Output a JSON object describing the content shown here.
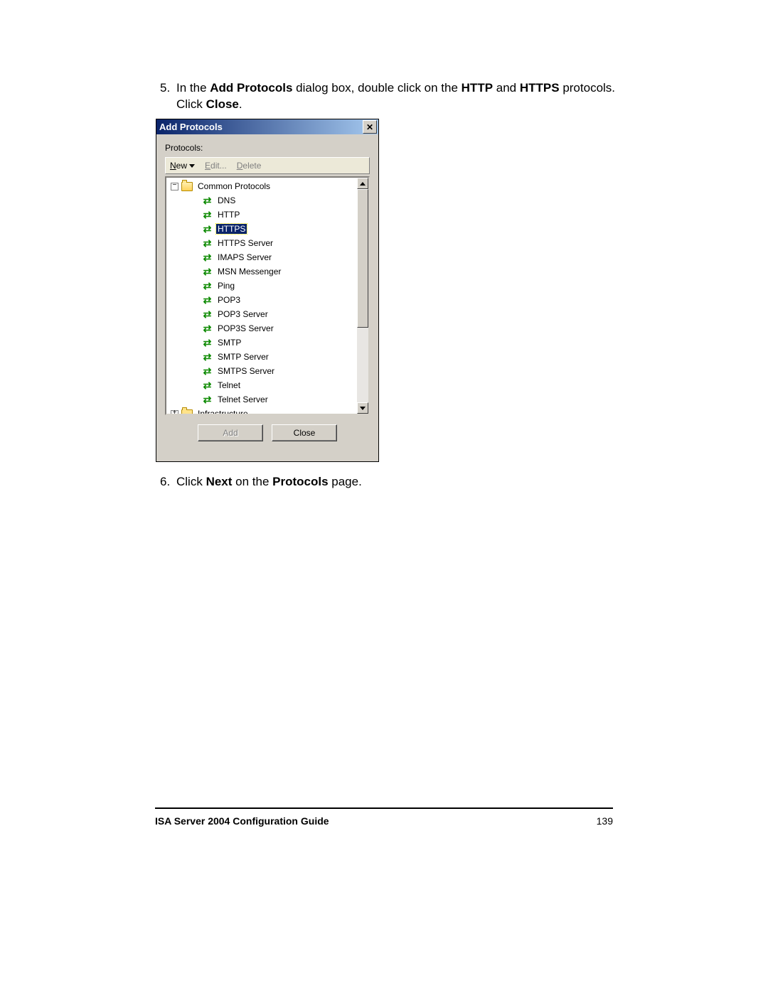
{
  "step5": {
    "num": "5.",
    "pre": "In the ",
    "b1": "Add Protocols",
    "mid1": " dialog box, double click on the ",
    "b2": "HTTP",
    "mid2": " and ",
    "b3": "HTTPS",
    "mid3": " protocols. Click ",
    "b4": "Close",
    "end": "."
  },
  "step6": {
    "num": "6.",
    "pre": "Click ",
    "b1": "Next",
    "mid": " on the ",
    "b2": "Protocols",
    "end": " page."
  },
  "dialog": {
    "title": "Add Protocols",
    "label": "Protocols:",
    "toolbar": {
      "new_pre": "N",
      "new_rest": "ew",
      "edit_pre": "E",
      "edit_rest": "dit...",
      "delete_pre": "D",
      "delete_rest": "elete"
    },
    "cat1": {
      "label": "Common Protocols"
    },
    "protocols": [
      {
        "label": "DNS",
        "selected": false
      },
      {
        "label": "HTTP",
        "selected": false
      },
      {
        "label": "HTTPS",
        "selected": true
      },
      {
        "label": "HTTPS Server",
        "selected": false
      },
      {
        "label": "IMAPS Server",
        "selected": false
      },
      {
        "label": "MSN Messenger",
        "selected": false
      },
      {
        "label": "Ping",
        "selected": false
      },
      {
        "label": "POP3",
        "selected": false
      },
      {
        "label": "POP3 Server",
        "selected": false
      },
      {
        "label": "POP3S Server",
        "selected": false
      },
      {
        "label": "SMTP",
        "selected": false
      },
      {
        "label": "SMTP Server",
        "selected": false
      },
      {
        "label": "SMTPS Server",
        "selected": false
      },
      {
        "label": "Telnet",
        "selected": false
      },
      {
        "label": "Telnet Server",
        "selected": false
      }
    ],
    "cat2": {
      "label": "Infrastructure"
    },
    "buttons": {
      "add": "Add",
      "close": "Close"
    }
  },
  "footer": {
    "title": "ISA Server 2004 Configuration Guide",
    "page": "139"
  }
}
